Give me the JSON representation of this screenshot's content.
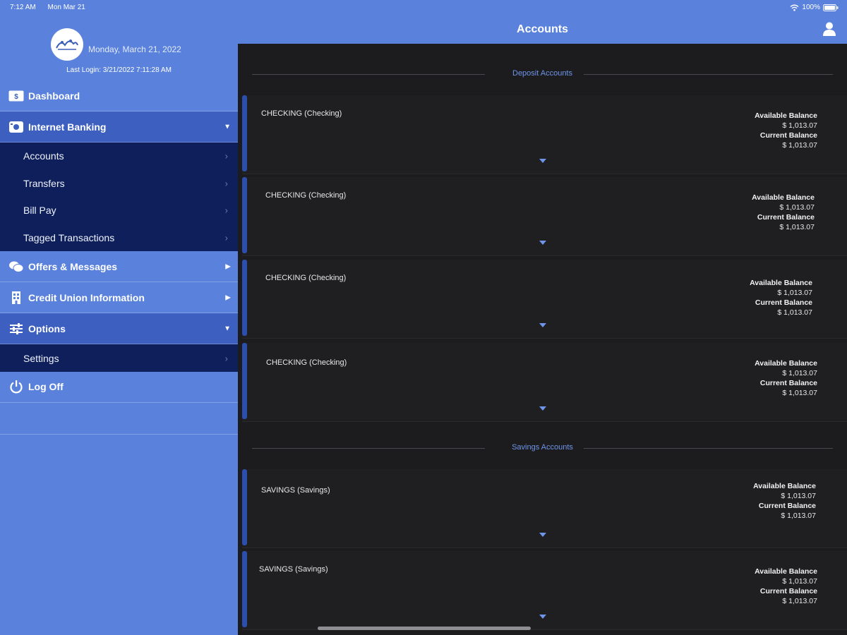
{
  "status": {
    "time": "7:12 AM",
    "date": "Mon Mar 21",
    "battery": "100%"
  },
  "profile": {
    "date": "Monday, March 21, 2022",
    "last_login": "Last Login: 3/21/2022 7:11:28 AM"
  },
  "sidebar": {
    "dashboard": {
      "label": "Dashboard",
      "icon_text": "$"
    },
    "internet_banking": {
      "label": "Internet Banking"
    },
    "internet_banking_items": [
      "Accounts",
      "Transfers",
      "Bill Pay",
      "Tagged Transactions"
    ],
    "offers": {
      "label": "Offers & Messages"
    },
    "cu_info": {
      "label": "Credit Union Information"
    },
    "options": {
      "label": "Options"
    },
    "options_items": [
      "Settings"
    ],
    "logoff": {
      "label": "Log Off"
    }
  },
  "header": {
    "title": "Accounts"
  },
  "sections": {
    "deposit": "Deposit Accounts",
    "savings": "Savings Accounts"
  },
  "accounts": [
    {
      "name": "CHECKING (Checking)",
      "available_label": "Available Balance",
      "available": "$ 1,013.07",
      "current_label": "Current Balance",
      "current": "$ 1,013.07"
    },
    {
      "name": "CHECKING (Checking)",
      "available_label": "Available Balance",
      "available": "$ 1,013.07",
      "current_label": "Current Balance",
      "current": "$ 1,013.07"
    },
    {
      "name": "CHECKING (Checking)",
      "available_label": "Available Balance",
      "available": "$ 1,013.07",
      "current_label": "Current Balance",
      "current": "$ 1,013.07"
    },
    {
      "name": "CHECKING (Checking)",
      "available_label": "Available Balance",
      "available": "$ 1,013.07",
      "current_label": "Current Balance",
      "current": "$ 1,013.07"
    },
    {
      "name": "SAVINGS (Savings)",
      "available_label": "Available Balance",
      "available": "$ 1,013.07",
      "current_label": "Current Balance",
      "current": "$ 1,013.07"
    },
    {
      "name": "SAVINGS (Savings)",
      "available_label": "Available Balance",
      "available": "$ 1,013.07",
      "current_label": "Current Balance",
      "current": "$ 1,013.07"
    }
  ],
  "colors": {
    "brand": "#5a82dc",
    "navy": "#0e1f5c",
    "accent_bar": "#2c4fae",
    "section_label": "#6f95ea"
  }
}
